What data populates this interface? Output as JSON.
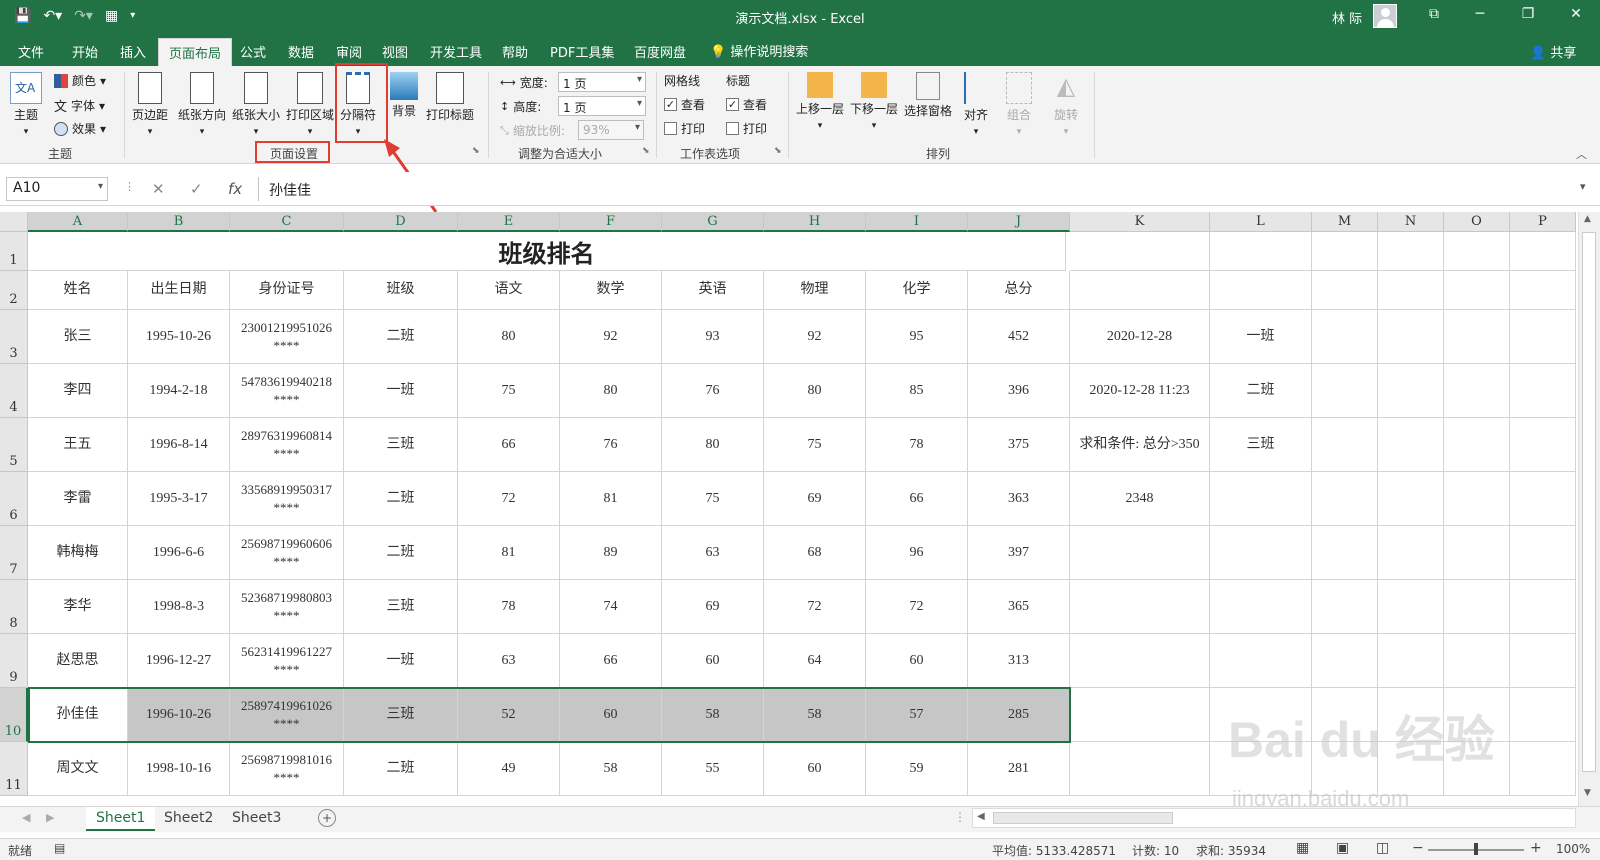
{
  "window": {
    "title": "演示文档.xlsx  -  Excel",
    "user": "林 际"
  },
  "ribbon_tabs": [
    "文件",
    "开始",
    "插入",
    "页面布局",
    "公式",
    "数据",
    "审阅",
    "视图",
    "开发工具",
    "帮助",
    "PDF工具集",
    "百度网盘"
  ],
  "tell_me": "操作说明搜索",
  "share": "共享",
  "ribbon": {
    "theme_group": {
      "theme": "主题",
      "colors": "颜色",
      "fonts": "字体",
      "effects": "效果",
      "label": "主题"
    },
    "page_setup": {
      "margins": "页边距",
      "orientation": "纸张方向",
      "size": "纸张大小",
      "print_area": "打印区域",
      "breaks": "分隔符",
      "background": "背景",
      "print_titles": "打印标题",
      "label": "页面设置"
    },
    "scale": {
      "width_label": "宽度:",
      "width_value": "1 页",
      "height_label": "高度:",
      "height_value": "1 页",
      "scale_label": "缩放比例:",
      "scale_value": "93%",
      "label": "调整为合适大小"
    },
    "sheet_options": {
      "gridlines": "网格线",
      "headings": "标题",
      "view": "查看",
      "print": "打印",
      "label": "工作表选项"
    },
    "arrange": {
      "bring_forward": "上移一层",
      "send_backward": "下移一层",
      "selection_pane": "选择窗格",
      "align": "对齐",
      "group": "组合",
      "rotate": "旋转",
      "label": "排列"
    }
  },
  "formula_bar": {
    "name_box": "A10",
    "fx": "fx",
    "content": "孙佳佳"
  },
  "columns": [
    "A",
    "B",
    "C",
    "D",
    "E",
    "F",
    "G",
    "H",
    "I",
    "J",
    "K",
    "L",
    "M",
    "N",
    "O",
    "P"
  ],
  "rows": [
    "1",
    "2",
    "3",
    "4",
    "5",
    "6",
    "7",
    "8",
    "9",
    "10",
    "11"
  ],
  "sheet": {
    "title": "班级排名",
    "headers": [
      "姓名",
      "出生日期",
      "身份证号",
      "班级",
      "语文",
      "数学",
      "英语",
      "物理",
      "化学",
      "总分"
    ],
    "data": [
      {
        "name": "张三",
        "birth": "1995-10-26",
        "id1": "23001219951026",
        "id2": "****",
        "cls": "二班",
        "s1": "80",
        "s2": "92",
        "s3": "93",
        "s4": "92",
        "s5": "95",
        "total": "452",
        "k": "2020-12-28",
        "l": "一班"
      },
      {
        "name": "李四",
        "birth": "1994-2-18",
        "id1": "54783619940218",
        "id2": "****",
        "cls": "一班",
        "s1": "75",
        "s2": "80",
        "s3": "76",
        "s4": "80",
        "s5": "85",
        "total": "396",
        "k": "2020-12-28 11:23",
        "l": "二班"
      },
      {
        "name": "王五",
        "birth": "1996-8-14",
        "id1": "28976319960814",
        "id2": "****",
        "cls": "三班",
        "s1": "66",
        "s2": "76",
        "s3": "80",
        "s4": "75",
        "s5": "78",
        "total": "375",
        "k": "求和条件: 总分>350",
        "l": "三班"
      },
      {
        "name": "李雷",
        "birth": "1995-3-17",
        "id1": "33568919950317",
        "id2": "****",
        "cls": "二班",
        "s1": "72",
        "s2": "81",
        "s3": "75",
        "s4": "69",
        "s5": "66",
        "total": "363",
        "k": "2348",
        "l": ""
      },
      {
        "name": "韩梅梅",
        "birth": "1996-6-6",
        "id1": "25698719960606",
        "id2": "****",
        "cls": "二班",
        "s1": "81",
        "s2": "89",
        "s3": "63",
        "s4": "68",
        "s5": "96",
        "total": "397",
        "k": "",
        "l": ""
      },
      {
        "name": "李华",
        "birth": "1998-8-3",
        "id1": "52368719980803",
        "id2": "****",
        "cls": "三班",
        "s1": "78",
        "s2": "74",
        "s3": "69",
        "s4": "72",
        "s5": "72",
        "total": "365",
        "k": "",
        "l": ""
      },
      {
        "name": "赵思思",
        "birth": "1996-12-27",
        "id1": "56231419961227",
        "id2": "****",
        "cls": "一班",
        "s1": "63",
        "s2": "66",
        "s3": "60",
        "s4": "64",
        "s5": "60",
        "total": "313",
        "k": "",
        "l": ""
      },
      {
        "name": "孙佳佳",
        "birth": "1996-10-26",
        "id1": "25897419961026",
        "id2": "****",
        "cls": "三班",
        "s1": "52",
        "s2": "60",
        "s3": "58",
        "s4": "58",
        "s5": "57",
        "total": "285",
        "k": "",
        "l": ""
      },
      {
        "name": "周文文",
        "birth": "1998-10-16",
        "id1": "25698719981016",
        "id2": "****",
        "cls": "二班",
        "s1": "49",
        "s2": "58",
        "s3": "55",
        "s4": "60",
        "s5": "59",
        "total": "281",
        "k": "",
        "l": ""
      }
    ]
  },
  "sheet_tabs": [
    "Sheet1",
    "Sheet2",
    "Sheet3"
  ],
  "status": {
    "ready": "就绪",
    "average": "平均值: 5133.428571",
    "count": "计数: 10",
    "sum": "求和: 35934",
    "zoom": "100%"
  },
  "watermark": {
    "main": "Bai du 经验",
    "url": "jingyan.baidu.com"
  },
  "colors": {
    "excel_green": "#217346",
    "highlight": "#e03c31"
  }
}
